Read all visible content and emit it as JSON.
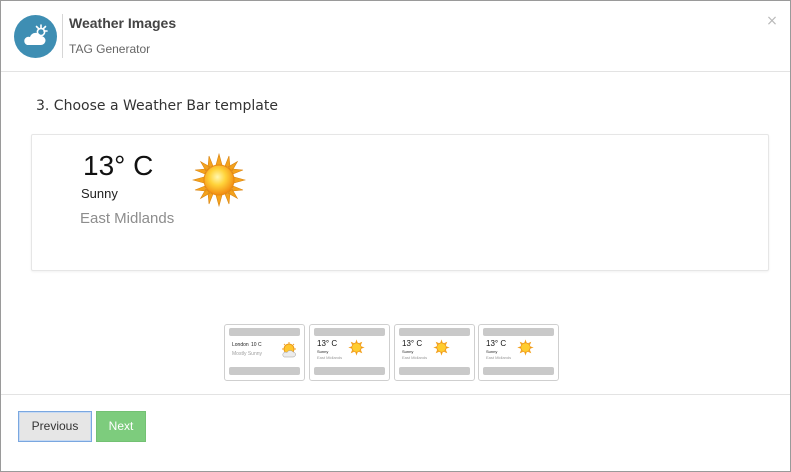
{
  "header": {
    "title": "Weather Images",
    "subtitle": "TAG Generator",
    "logo_icon": "cloud-sun-icon",
    "close_label": "×",
    "logo_color": "#3e8eb3"
  },
  "step": {
    "title": "3. Choose a Weather Bar template"
  },
  "preview": {
    "temperature": "13° C",
    "condition": "Sunny",
    "location": "East Midlands",
    "icon": "sun-icon"
  },
  "templates": [
    {
      "location": "London",
      "temperature": "10 C",
      "condition": "Mostly Sunny",
      "icon": "sun-cloud-icon"
    },
    {
      "temperature": "13° C",
      "condition": "Sunny",
      "location": "East Midlands",
      "icon": "sun-icon"
    },
    {
      "temperature": "13° C",
      "condition": "Sunny",
      "location": "East Midlands",
      "icon": "sun-icon"
    },
    {
      "temperature": "13° C",
      "condition": "Sunny",
      "location": "East Midlands",
      "icon": "sun-icon"
    }
  ],
  "footer": {
    "previous_label": "Previous",
    "next_label": "Next",
    "next_color": "#7dcc7d"
  }
}
